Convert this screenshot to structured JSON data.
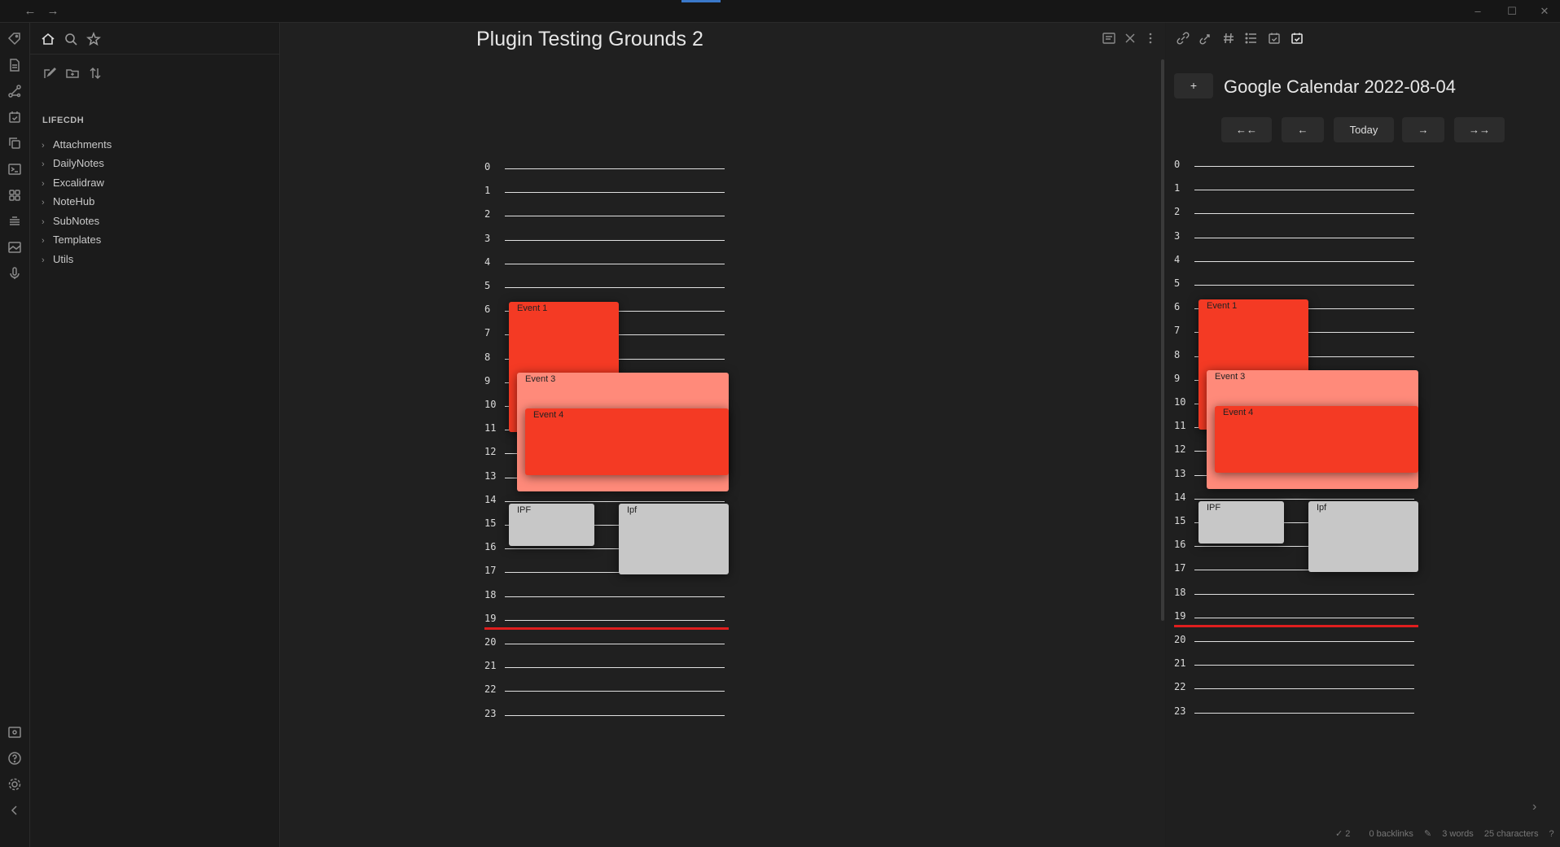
{
  "window": {
    "back_icon": "arrow-left-icon",
    "forward_icon": "arrow-right-icon"
  },
  "ribbon": {
    "icons": [
      "tag-icon",
      "file-icon",
      "graph-icon",
      "calendar-check-icon",
      "copy-icon",
      "terminal-icon",
      "apps-icon",
      "layers-icon",
      "image-icon",
      "mic-icon",
      "vault-switch-icon",
      "help-icon",
      "settings-icon",
      "collapse-icon"
    ]
  },
  "explorer": {
    "vault_name": "LIFECDH",
    "folders": [
      {
        "label": "Attachments"
      },
      {
        "label": "DailyNotes"
      },
      {
        "label": "Excalidraw"
      },
      {
        "label": "NoteHub"
      },
      {
        "label": "SubNotes"
      },
      {
        "label": "Templates"
      },
      {
        "label": "Utils"
      }
    ]
  },
  "main": {
    "title": "Plugin Testing Grounds 2"
  },
  "right": {
    "plus_label": "+",
    "title": "Google Calendar 2022-08-04",
    "nav": {
      "back_week": "←←",
      "back_day": "←",
      "today": "Today",
      "forward_day": "→",
      "forward_week": "→→"
    }
  },
  "timeline": {
    "hours": [
      "0",
      "1",
      "2",
      "3",
      "4",
      "5",
      "6",
      "7",
      "8",
      "9",
      "10",
      "11",
      "12",
      "13",
      "14",
      "15",
      "16",
      "17",
      "18",
      "19",
      "20",
      "21",
      "22",
      "23"
    ],
    "now_hour": 19.7,
    "events": [
      {
        "name": "Event 1",
        "start": 5.6,
        "end": 11.1,
        "col": 0,
        "color": "red"
      },
      {
        "name": "Event 3",
        "start": 8.6,
        "end": 13.6,
        "col": 1,
        "color": "pink"
      },
      {
        "name": "Event 4",
        "start": 10.1,
        "end": 12.9,
        "col": 2,
        "color": "red"
      },
      {
        "name": "IPF",
        "start": 14.1,
        "end": 15.9,
        "col": 0,
        "color": "grey"
      },
      {
        "name": "Ipf",
        "start": 14.1,
        "end": 17.1,
        "col": 3,
        "color": "grey"
      }
    ]
  },
  "status": {
    "sync": "2",
    "backlinks": "0 backlinks",
    "words": "3 words",
    "characters": "25 characters"
  }
}
